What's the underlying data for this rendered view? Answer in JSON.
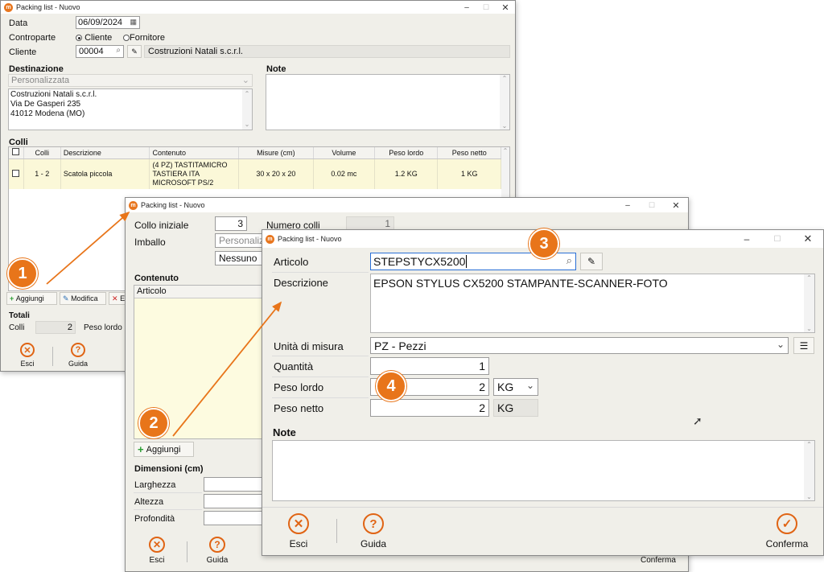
{
  "window_back": {
    "title": "Packing list - Nuovo",
    "data_label": "Data",
    "data_value": "06/09/2024",
    "controparte_label": "Controparte",
    "radio_cliente": "Cliente",
    "radio_fornitore": "Fornitore",
    "cliente_label": "Cliente",
    "cliente_code": "00004",
    "cliente_name": "Costruzioni Natali s.c.r.l.",
    "destinazione_label": "Destinazione",
    "destinazione_select": "Personalizzata",
    "address_lines": [
      "Costruzioni Natali s.c.r.l.",
      "Via De Gasperi 235",
      "41012 Modena (MO)"
    ],
    "note_label": "Note",
    "colli_label": "Colli",
    "columns": [
      "Colli",
      "Descrizione",
      "Contenuto",
      "Misure (cm)",
      "Volume",
      "Peso lordo",
      "Peso netto"
    ],
    "rows": [
      {
        "colli": "1 - 2",
        "descrizione": "Scatola piccola",
        "contenuto": [
          "(4 PZ) TASTITAMICRO",
          "TASTIERA ITA",
          "MICROSOFT PS/2"
        ],
        "misure": "30 x 20 x 20",
        "volume": "0.02 mc",
        "peso_lordo": "1.2 KG",
        "peso_netto": "1 KG"
      }
    ],
    "btn_aggiungi": "Aggiungi",
    "btn_modifica": "Modifica",
    "btn_elimina_partial": "E",
    "totali_label": "Totali",
    "colli_tot_label": "Colli",
    "colli_tot_value": "2",
    "peso_lordo_label": "Peso lordo",
    "footer_esci": "Esci",
    "footer_guida": "Guida"
  },
  "window_mid": {
    "title": "Packing list - Nuovo",
    "collo_iniziale_label": "Collo iniziale",
    "collo_iniziale_value": "3",
    "numero_colli_label": "Numero colli",
    "numero_colli_value": "1",
    "imballo_label": "Imballo",
    "imballo_value": "Personaliz",
    "imballo_value2": "Nessuno",
    "contenuto_label": "Contenuto",
    "articolo_col": "Articolo",
    "btn_aggiungi": "Aggiungi",
    "dimensioni_label": "Dimensioni (cm)",
    "larghezza_label": "Larghezza",
    "altezza_label": "Altezza",
    "profondita_label": "Profondità",
    "footer_esci": "Esci",
    "footer_guida": "Guida",
    "footer_conferma": "Conferma"
  },
  "window_front": {
    "title": "Packing list - Nuovo",
    "articolo_label": "Articolo",
    "articolo_value": "STEPSTYCX5200",
    "descrizione_label": "Descrizione",
    "descrizione_value": "EPSON STYLUS  CX5200 STAMPANTE-SCANNER-FOTO",
    "unita_label": "Unità di misura",
    "unita_value": "PZ - Pezzi",
    "quantita_label": "Quantità",
    "quantita_value": "1",
    "peso_lordo_label": "Peso lordo",
    "peso_lordo_value": "2",
    "peso_lordo_unit": "KG",
    "peso_netto_label": "Peso netto",
    "peso_netto_value": "2",
    "peso_netto_unit": "KG",
    "note_label": "Note",
    "footer_esci": "Esci",
    "footer_guida": "Guida",
    "footer_conferma": "Conferma"
  },
  "callouts": [
    "1",
    "2",
    "3",
    "4"
  ],
  "colors": {
    "accent": "#e8751a",
    "row_highlight": "#fbf8d8",
    "panel": "#f0efe9"
  }
}
